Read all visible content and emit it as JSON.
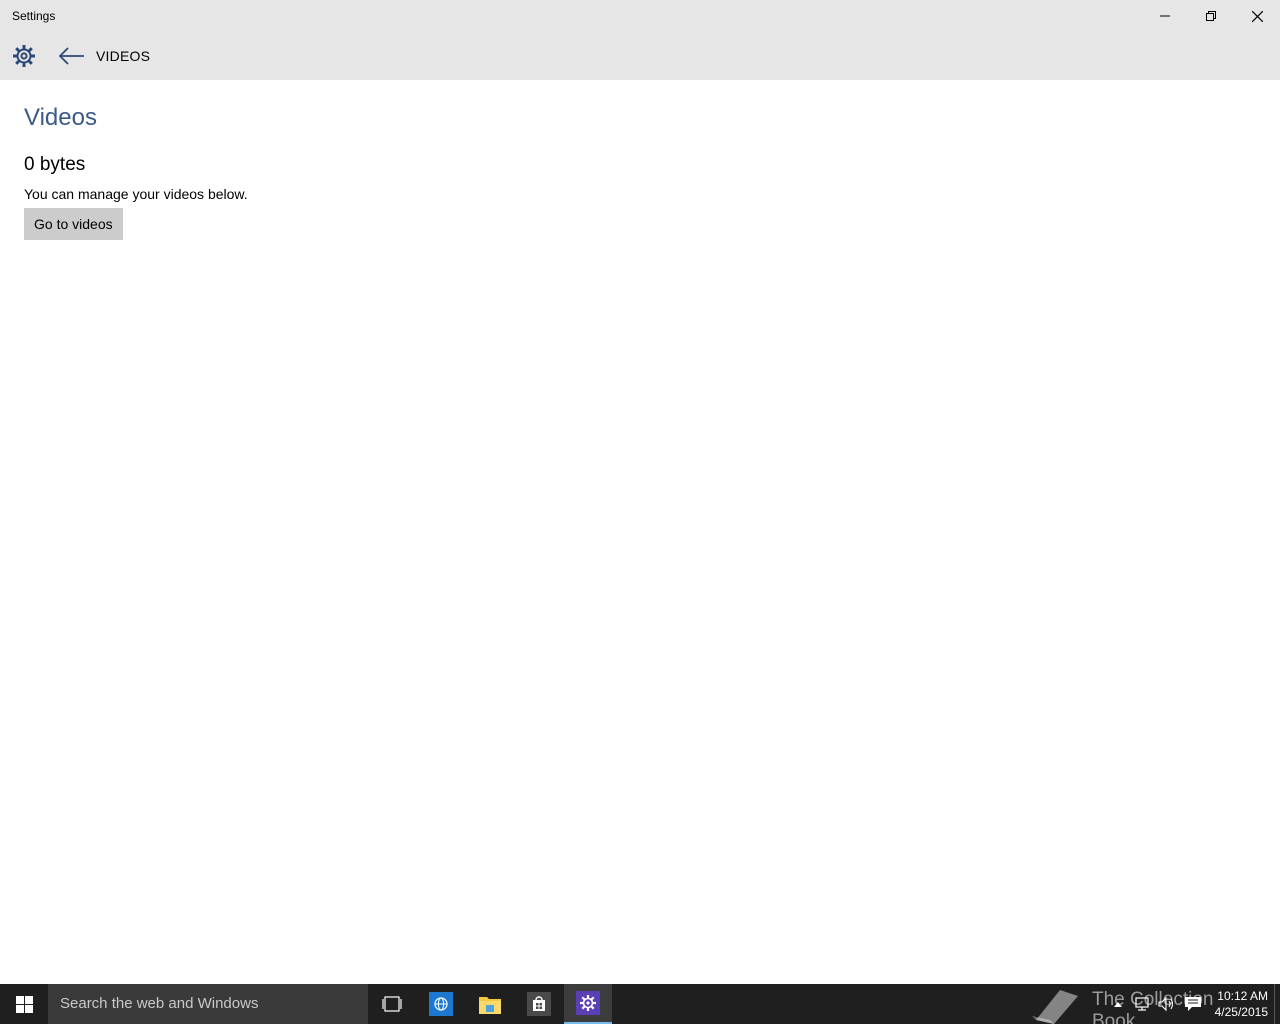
{
  "window": {
    "title": "Settings"
  },
  "caption": {
    "minimize": "minimize-icon",
    "maximize": "restore-icon",
    "close": "close-icon"
  },
  "header": {
    "page_name": "VIDEOS"
  },
  "content": {
    "heading": "Videos",
    "size": "0 bytes",
    "description": "You can manage your videos below.",
    "button_label": "Go to videos"
  },
  "taskbar": {
    "search_placeholder": "Search the web and Windows",
    "apps": [
      "task-view",
      "internet-explorer",
      "file-explorer",
      "store",
      "settings"
    ],
    "active_app": "settings",
    "clock_time": "10:12 AM",
    "clock_date": "4/25/2015",
    "watermark": "The Collection Book"
  },
  "colors": {
    "titlebar_bg": "#e6e6e6",
    "heading": "#3b5a88",
    "button_bg": "#cccccc",
    "taskbar_bg": "#1f1f1f",
    "search_bg": "#3a3a3a",
    "settings_app_tile": "#5b3fb5"
  }
}
